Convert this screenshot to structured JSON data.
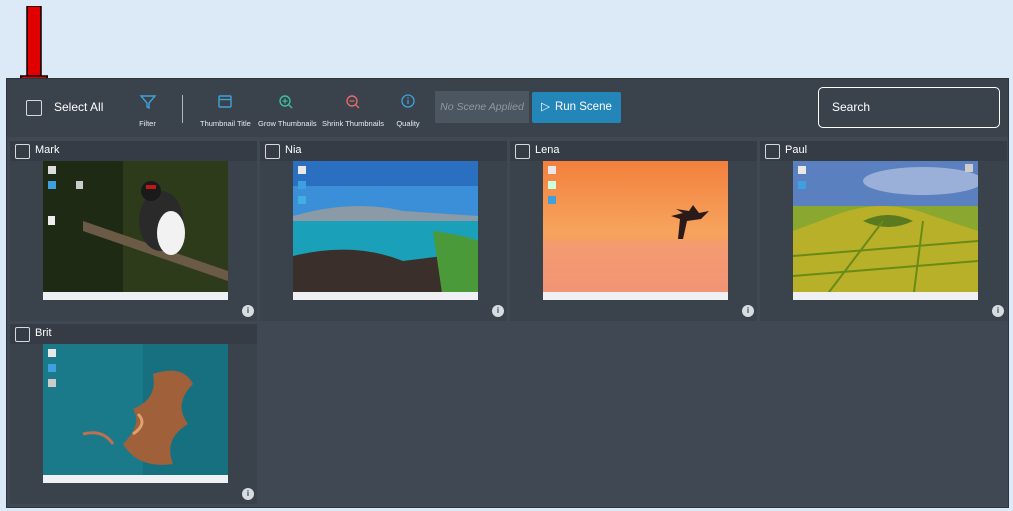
{
  "toolbar": {
    "select_all_label": "Select All",
    "tools": [
      {
        "label": "Filter",
        "icon": "filter-icon"
      },
      {
        "label": "Thumbnail Title",
        "icon": "window-icon"
      },
      {
        "label": "Grow Thumbnails",
        "icon": "zoom-in-icon"
      },
      {
        "label": "Shrink Thumbnails",
        "icon": "zoom-out-icon"
      },
      {
        "label": "Quality",
        "icon": "info-icon"
      }
    ],
    "scene_placeholder": "No Scene Applied",
    "run_scene_label": "Run Scene",
    "search_placeholder": "Search"
  },
  "cards": [
    {
      "name": "Mark",
      "wallpaper": "woodpecker",
      "info": "i"
    },
    {
      "name": "Nia",
      "wallpaper": "coastline",
      "info": "i"
    },
    {
      "name": "Lena",
      "wallpaper": "sunset-tree",
      "info": "i"
    },
    {
      "name": "Paul",
      "wallpaper": "fields",
      "info": "i"
    },
    {
      "name": "Brit",
      "wallpaper": "aerial-reef",
      "info": "i"
    }
  ],
  "colors": {
    "accent": "#2486b8",
    "arrow": "#e00000",
    "panel": "#404953",
    "background": "#dce9f7"
  }
}
